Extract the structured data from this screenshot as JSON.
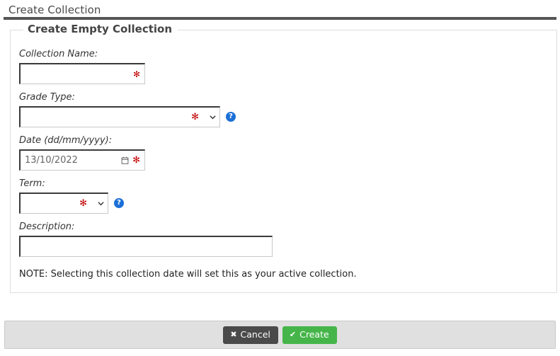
{
  "header": {
    "title": "Create Collection"
  },
  "panel": {
    "legend": "Create Empty Collection"
  },
  "form": {
    "collection_name": {
      "label": "Collection Name:",
      "value": "",
      "placeholder": "",
      "required_mark": "✻"
    },
    "grade_type": {
      "label": "Grade Type:",
      "value": "",
      "required_mark": "✻",
      "chevron_icon": "chevron-down-icon",
      "help_icon": "?"
    },
    "date": {
      "label": "Date (dd/mm/yyyy):",
      "value": "13/10/2022",
      "placeholder": "dd/mm/yyyy",
      "required_mark": "✻",
      "calendar_icon": "calendar-icon"
    },
    "term": {
      "label": "Term:",
      "value": "",
      "required_mark": "✻",
      "chevron_icon": "chevron-down-icon",
      "help_icon": "?"
    },
    "description": {
      "label": "Description:",
      "value": "",
      "placeholder": ""
    },
    "note": "NOTE: Selecting this collection date will set this as your active collection."
  },
  "footer": {
    "cancel_label": "Cancel",
    "cancel_icon": "✖",
    "create_label": "Create",
    "create_icon": "✔"
  },
  "colors": {
    "divider": "#555555",
    "required": "#c00000",
    "help_badge": "#1c6fd6",
    "create_button": "#45b549",
    "cancel_button": "#4a4a4a",
    "footer_band": "#e0e0e0"
  }
}
